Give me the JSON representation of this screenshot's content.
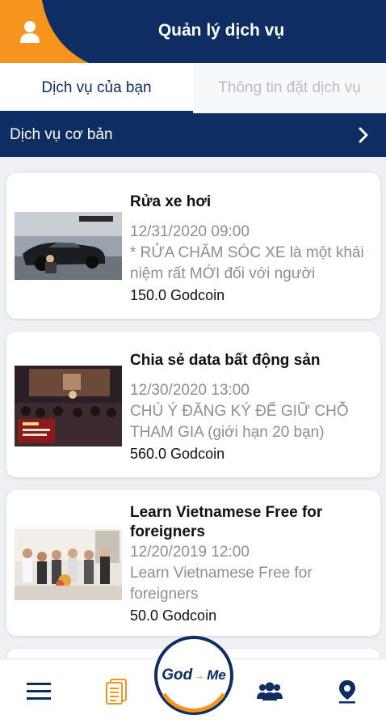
{
  "header": {
    "title": "Quản lý dịch vụ",
    "avatar_icon": "user-icon",
    "accent": "#f7941d",
    "bg": "#0e2d63"
  },
  "tabs": [
    {
      "label": "Dịch vụ của bạn",
      "active": true
    },
    {
      "label": "Thông tin đặt dịch vụ",
      "active": false
    }
  ],
  "section": {
    "title": "Dịch vụ cơ bản",
    "icon": "chevron-right-icon"
  },
  "services": [
    {
      "title": "Rửa xe hơi",
      "date": "12/31/2020 09:00",
      "description": "* RỬA CHĂM SÓC XE là một khái niệm rất MỚI đối với người",
      "price": "150.0 Godcoin"
    },
    {
      "title": "Chia sẻ data bất động sản",
      "date": "12/30/2020 13:00",
      "description": "CHÚ Ý ĐĂNG KÝ ĐỂ GIỮ CHỖ THAM GIA (giới hạn 20 bạn)",
      "price": "560.0 Godcoin"
    },
    {
      "title": "Learn Vietnamese Free for foreigners",
      "date": "12/20/2019 12:00",
      "description": "Learn Vietnamese Free for foreigners",
      "price": "50.0 Godcoin"
    }
  ],
  "bottom_nav": {
    "items": [
      "menu-icon",
      "document-icon",
      "users-icon",
      "location-pin-icon"
    ],
    "logo": {
      "god": "God",
      "me": "Me"
    }
  }
}
